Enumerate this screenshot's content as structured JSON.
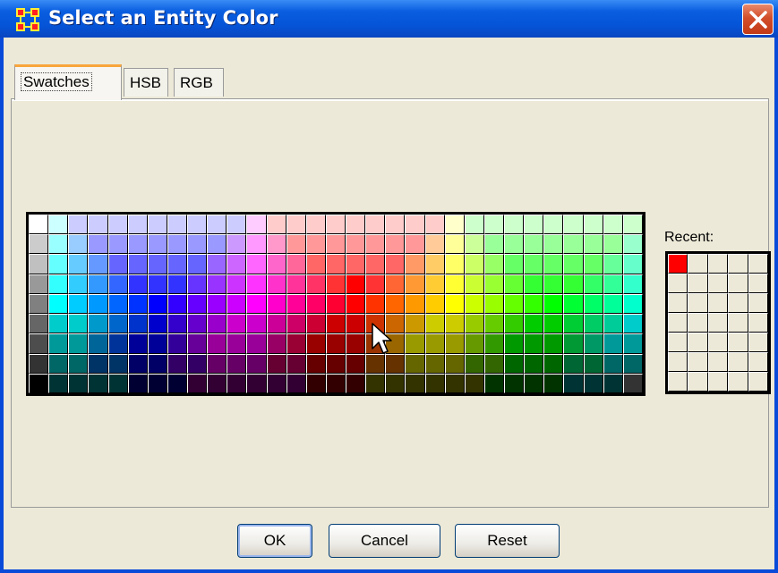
{
  "window": {
    "title": "Select an Entity Color",
    "icon": "grid-app-icon",
    "close_icon": "close-icon"
  },
  "tabs": [
    {
      "label": "Swatches",
      "active": true
    },
    {
      "label": "HSB",
      "active": false
    },
    {
      "label": "RGB",
      "active": false
    }
  ],
  "swatches": {
    "columns": 31,
    "rows": 9,
    "colors": [
      [
        "#ffffff",
        "#ccffff",
        "#ccccff",
        "#ccccff",
        "#ccccff",
        "#ccccff",
        "#ccccff",
        "#ccccff",
        "#ccccff",
        "#ccccff",
        "#ccccff",
        "#ffccff",
        "#ffcccc",
        "#ffcccc",
        "#ffcccc",
        "#ffcccc",
        "#ffcccc",
        "#ffcccc",
        "#ffcccc",
        "#ffcccc",
        "#ffcccc",
        "#ffffcc",
        "#ccffcc",
        "#ccffcc",
        "#ccffcc",
        "#ccffcc",
        "#ccffcc",
        "#ccffcc",
        "#ccffcc",
        "#ccffcc",
        "#ccffcc"
      ],
      [
        "#cccccc",
        "#99ffff",
        "#99ccff",
        "#9999ff",
        "#9999ff",
        "#9999ff",
        "#9999ff",
        "#9999ff",
        "#9999ff",
        "#9999ff",
        "#cc99ff",
        "#ff99ff",
        "#ff99cc",
        "#ff9999",
        "#ff9999",
        "#ff9999",
        "#ff9999",
        "#ff9999",
        "#ff9999",
        "#ff9999",
        "#ffcc99",
        "#ffff99",
        "#ccff99",
        "#99ff99",
        "#99ff99",
        "#99ff99",
        "#99ff99",
        "#99ff99",
        "#99ff99",
        "#99ff99",
        "#99ffcc"
      ],
      [
        "#c0c0c0",
        "#66ffff",
        "#66ccff",
        "#6699ff",
        "#6666ff",
        "#6666ff",
        "#6666ff",
        "#6666ff",
        "#6666ff",
        "#9966ff",
        "#cc66ff",
        "#ff66ff",
        "#ff66cc",
        "#ff6699",
        "#ff6666",
        "#ff6666",
        "#ff6666",
        "#ff6666",
        "#ff6666",
        "#ff9966",
        "#ffcc66",
        "#ffff66",
        "#ccff66",
        "#99ff66",
        "#66ff66",
        "#66ff66",
        "#66ff66",
        "#66ff66",
        "#66ff66",
        "#66ff99",
        "#66ffcc"
      ],
      [
        "#999999",
        "#33ffff",
        "#33ccff",
        "#3399ff",
        "#3366ff",
        "#3333ff",
        "#3333ff",
        "#3333ff",
        "#6633ff",
        "#9933ff",
        "#cc33ff",
        "#ff33ff",
        "#ff33cc",
        "#ff3399",
        "#ff3366",
        "#ff3333",
        "#ff0000",
        "#ff3333",
        "#ff6633",
        "#ff9933",
        "#ffcc33",
        "#ffff33",
        "#ccff33",
        "#99ff33",
        "#66ff33",
        "#33ff33",
        "#33ff33",
        "#33ff33",
        "#33ff66",
        "#33ff99",
        "#33ffcc"
      ],
      [
        "#808080",
        "#00ffff",
        "#00ccff",
        "#0099ff",
        "#0066ff",
        "#0033ff",
        "#0000ff",
        "#3300ff",
        "#6600ff",
        "#9900ff",
        "#cc00ff",
        "#ff00ff",
        "#ff00cc",
        "#ff0099",
        "#ff0066",
        "#ff0033",
        "#ff0000",
        "#ff3300",
        "#ff6600",
        "#ff9900",
        "#ffcc00",
        "#ffff00",
        "#ccff00",
        "#99ff00",
        "#66ff00",
        "#33ff00",
        "#00ff00",
        "#00ff33",
        "#00ff66",
        "#00ff99",
        "#00ffcc"
      ],
      [
        "#666666",
        "#00cccc",
        "#00cccc",
        "#0099cc",
        "#0066cc",
        "#0033cc",
        "#0000cc",
        "#3300cc",
        "#6600cc",
        "#9900cc",
        "#cc00cc",
        "#cc00cc",
        "#cc0099",
        "#cc0066",
        "#cc0033",
        "#cc0000",
        "#cc0000",
        "#cc3300",
        "#cc6600",
        "#cc9900",
        "#cccc00",
        "#cccc00",
        "#99cc00",
        "#66cc00",
        "#33cc00",
        "#00cc00",
        "#00cc00",
        "#00cc33",
        "#00cc66",
        "#00cc99",
        "#00cccc"
      ],
      [
        "#4d4d4d",
        "#009999",
        "#009999",
        "#006699",
        "#003399",
        "#000099",
        "#000099",
        "#330099",
        "#660099",
        "#990099",
        "#990099",
        "#990099",
        "#990066",
        "#990033",
        "#990000",
        "#990000",
        "#990000",
        "#993300",
        "#996600",
        "#999900",
        "#999900",
        "#999900",
        "#669900",
        "#339900",
        "#009900",
        "#009900",
        "#009900",
        "#009933",
        "#009966",
        "#009999",
        "#009999"
      ],
      [
        "#333333",
        "#006666",
        "#006666",
        "#003366",
        "#003366",
        "#000066",
        "#000066",
        "#330066",
        "#330066",
        "#660066",
        "#660066",
        "#660066",
        "#660033",
        "#660033",
        "#660000",
        "#660000",
        "#660000",
        "#663300",
        "#663300",
        "#666600",
        "#666600",
        "#666600",
        "#336600",
        "#336600",
        "#006600",
        "#006600",
        "#006600",
        "#006633",
        "#006633",
        "#006666",
        "#006666"
      ],
      [
        "#000000",
        "#003333",
        "#003333",
        "#003333",
        "#003333",
        "#000033",
        "#000033",
        "#000033",
        "#330033",
        "#330033",
        "#330033",
        "#330033",
        "#330033",
        "#330033",
        "#330000",
        "#330000",
        "#330000",
        "#333300",
        "#333300",
        "#333300",
        "#333300",
        "#333300",
        "#333300",
        "#003300",
        "#003300",
        "#003300",
        "#003300",
        "#003333",
        "#003333",
        "#003333",
        "#333333"
      ]
    ]
  },
  "recent": {
    "label": "Recent:",
    "columns": 5,
    "rows": 7,
    "colors": [
      "#ff0000"
    ]
  },
  "buttons": {
    "ok": "OK",
    "cancel": "Cancel",
    "reset": "Reset"
  },
  "colors": {
    "titlebar": "#0553d6",
    "dialog_bg": "#ece9d8",
    "active_tab_accent": "#f9a53c",
    "close_button": "#d24e2a"
  }
}
